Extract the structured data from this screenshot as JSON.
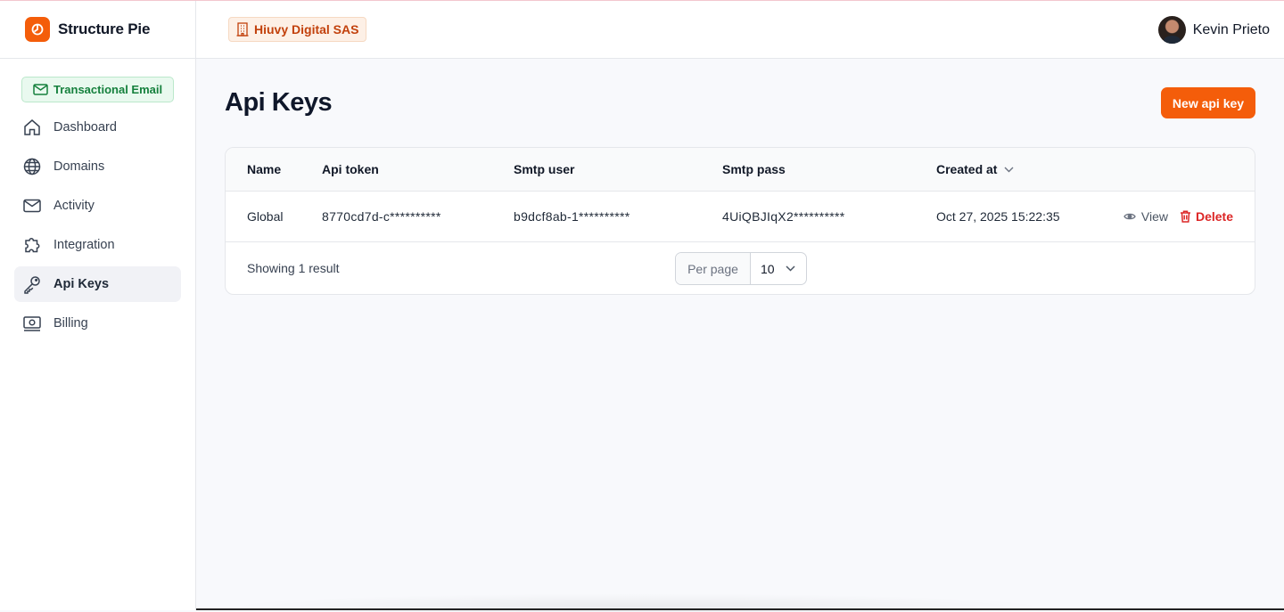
{
  "brand": {
    "name": "Structure Pie"
  },
  "org": {
    "name": "Hiuvy Digital SAS"
  },
  "user": {
    "name": "Kevin Prieto"
  },
  "product": {
    "label": "Transactional Email"
  },
  "sidebar": {
    "items": [
      {
        "label": "Dashboard",
        "icon": "home-icon"
      },
      {
        "label": "Domains",
        "icon": "globe-icon"
      },
      {
        "label": "Activity",
        "icon": "envelope-icon"
      },
      {
        "label": "Integration",
        "icon": "puzzle-icon"
      },
      {
        "label": "Api Keys",
        "icon": "key-icon",
        "active": true
      },
      {
        "label": "Billing",
        "icon": "banknote-icon"
      }
    ]
  },
  "page": {
    "title": "Api Keys",
    "new_button_label": "New api key"
  },
  "table": {
    "columns": [
      "Name",
      "Api token",
      "Smtp user",
      "Smtp pass",
      "Created at"
    ],
    "rows": [
      {
        "name": "Global",
        "api_token": "8770cd7d-c**********",
        "smtp_user": "b9dcf8ab-1**********",
        "smtp_pass": "4UiQBJIqX2**********",
        "created_at": "Oct 27, 2025 15:22:35",
        "view_label": "View",
        "delete_label": "Delete"
      }
    ],
    "footer": {
      "showing": "Showing 1 result",
      "per_page_label": "Per page",
      "per_page_value": "10"
    }
  },
  "colors": {
    "accent": "#f45d0a",
    "danger": "#dc2626",
    "success": "#15803d"
  }
}
